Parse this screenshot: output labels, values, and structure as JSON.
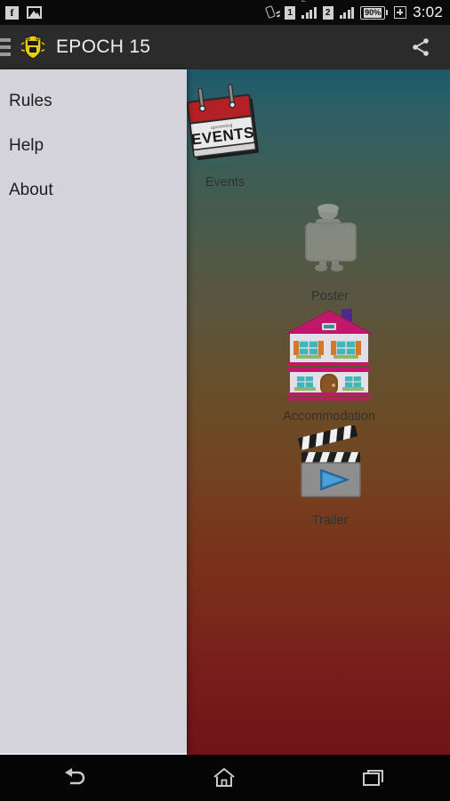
{
  "status_bar": {
    "left_icons": [
      {
        "name": "facebook-icon",
        "glyph": "f"
      },
      {
        "name": "gallery-icon",
        "glyph": ""
      }
    ],
    "vibrate_icon": "vibrate-icon",
    "sim1_label": "1",
    "sim1_network": "E",
    "sim2_label": "2",
    "battery_percent": "90%",
    "charging_icon": "charging-icon",
    "time": "3:02"
  },
  "action_bar": {
    "menu_icon": "hamburger-menu-icon",
    "logo_icon": "epoch-crest-logo",
    "title": "EPOCH 15",
    "share_icon": "share-icon"
  },
  "drawer": {
    "items": [
      {
        "label": "Rules"
      },
      {
        "label": "Help"
      },
      {
        "label": "About"
      }
    ]
  },
  "main": {
    "tiles": [
      {
        "label": "Events",
        "icon": "calendar-icon"
      },
      {
        "label": "Poster",
        "icon": "poster-person-icon"
      },
      {
        "label": "Accommodation",
        "icon": "house-icon"
      },
      {
        "label": "Trailer",
        "icon": "clapperboard-play-icon"
      }
    ]
  },
  "nav_bar": {
    "back": "back-button",
    "home": "home-button",
    "recents": "recents-button"
  },
  "colors": {
    "drawer_bg": "#d4d3dc",
    "action_bar_bg": "#2b2b2b",
    "bg_top": "#1e5a6b",
    "bg_bottom": "#701418",
    "accent_red": "#b32025",
    "accent_pink": "#c2186b"
  }
}
